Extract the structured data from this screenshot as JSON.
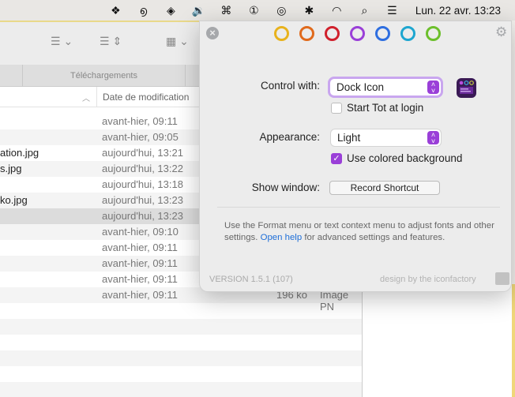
{
  "menubar": {
    "icons": [
      "dropbox-icon",
      "snail-icon",
      "layers-icon",
      "volume-icon",
      "command-icon",
      "timer-icon",
      "airdrop-icon",
      "bluetooth-icon",
      "wifi-icon",
      "search-icon",
      "control-center-icon"
    ],
    "glyphs": [
      "❖",
      "൭",
      "◈",
      "🔉",
      "⌘",
      "①",
      "◎",
      "✱",
      "◠",
      "⌕",
      "☰"
    ],
    "clock": "Lun. 22 avr.  13:23"
  },
  "finder": {
    "tab": "Téléchargements",
    "column_date": "Date de modification",
    "rows": [
      {
        "name": "",
        "date": "avant-hier, 09:11"
      },
      {
        "name": "",
        "date": "avant-hier, 09:05"
      },
      {
        "name": "ation.jpg",
        "date": "aujourd'hui, 13:21"
      },
      {
        "name": "s.jpg",
        "date": "aujourd'hui, 13:22"
      },
      {
        "name": "",
        "date": "aujourd'hui, 13:18"
      },
      {
        "name": "ko.jpg",
        "date": "aujourd'hui, 13:23"
      },
      {
        "name": "",
        "date": "aujourd'hui, 13:23",
        "selected": true
      },
      {
        "name": "",
        "date": "avant-hier, 09:10"
      },
      {
        "name": "",
        "date": "avant-hier, 09:11"
      },
      {
        "name": "",
        "date": "avant-hier, 09:11"
      },
      {
        "name": "",
        "date": "avant-hier, 09:11"
      },
      {
        "name": "",
        "date": "avant-hier, 09:11",
        "size": "196 ko",
        "kind": "Image PN"
      }
    ]
  },
  "tot": {
    "dot_colors": [
      "#e8b21c",
      "#e06a1c",
      "#d0202c",
      "#9a3fd8",
      "#2e6ee0",
      "#1ea6d0",
      "#6cbf2c"
    ],
    "accent": "#9a3fd8",
    "control_label": "Control with:",
    "control_value": "Dock Icon",
    "start_login": "Start Tot at login",
    "start_login_checked": false,
    "appearance_label": "Appearance:",
    "appearance_value": "Light",
    "colored_bg": "Use colored background",
    "colored_bg_checked": true,
    "show_window_label": "Show window:",
    "record_shortcut": "Record Shortcut",
    "help_pre": "Use the Format menu or text context menu to adjust fonts and other settings. ",
    "help_link": "Open help",
    "help_post": " for advanced settings and features.",
    "version": "VERSION 1.5.1 (107)",
    "credit": "design by the iconfactory"
  }
}
